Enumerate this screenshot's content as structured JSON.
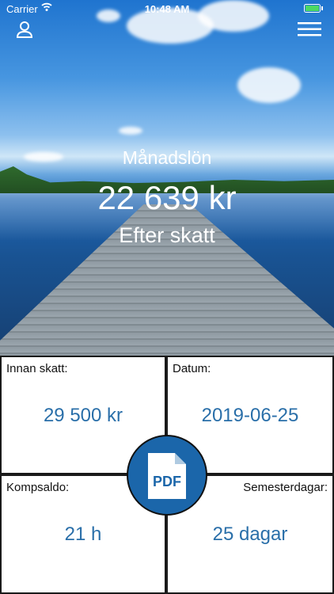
{
  "status_bar": {
    "carrier": "Carrier",
    "time": "10:48 AM"
  },
  "header": {
    "title": "Månadslön",
    "amount": "22 639 kr",
    "subtitle": "Efter skatt"
  },
  "cards": [
    {
      "label": "Innan skatt:",
      "value": "29 500 kr"
    },
    {
      "label": "Datum:",
      "value": "2019-06-25"
    },
    {
      "label": "Kompsaldo:",
      "value": "21 h"
    },
    {
      "label": "Semesterdagar:",
      "value": "25 dagar"
    }
  ],
  "pdf_button": {
    "text": "PDF"
  },
  "colors": {
    "accent": "#1b66aa",
    "value_text": "#2a6fa9"
  },
  "icons": [
    "wifi-icon",
    "battery-icon",
    "user-icon",
    "menu-icon",
    "pdf-icon"
  ]
}
